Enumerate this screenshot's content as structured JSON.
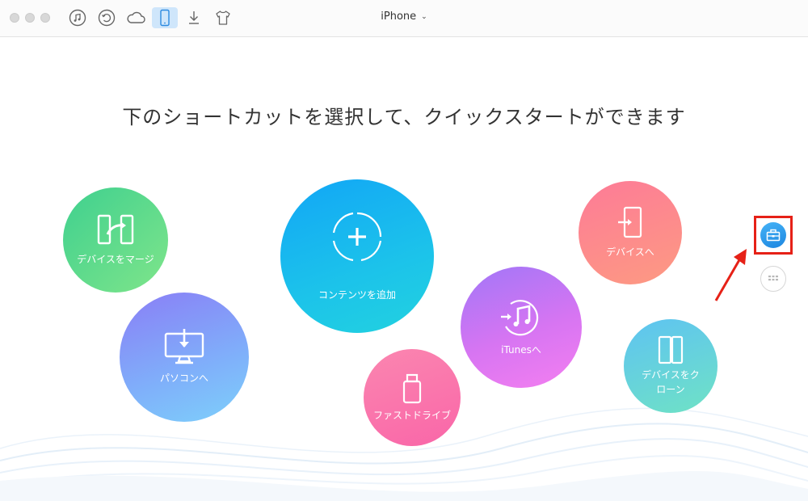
{
  "window": {
    "device_title": "iPhone"
  },
  "toolbar": {
    "icons": [
      "music-note-icon",
      "restore-icon",
      "cloud-icon",
      "phone-icon",
      "download-icon",
      "tshirt-icon"
    ]
  },
  "main": {
    "headline": "下のショートカットを選択して、クイックスタートができます",
    "shortcuts": {
      "merge": "デバイスをマージ",
      "to_pc": "パソコンへ",
      "add_content": "コンテンツを追加",
      "fast_drive": "ファストドライブ",
      "to_itunes": "iTunesへ",
      "to_device": "デバイスへ",
      "clone_line1": "デバイスをク",
      "clone_line2": "ローン"
    }
  },
  "colors": {
    "accent": "#2d9cf0",
    "highlight": "#e62117"
  }
}
